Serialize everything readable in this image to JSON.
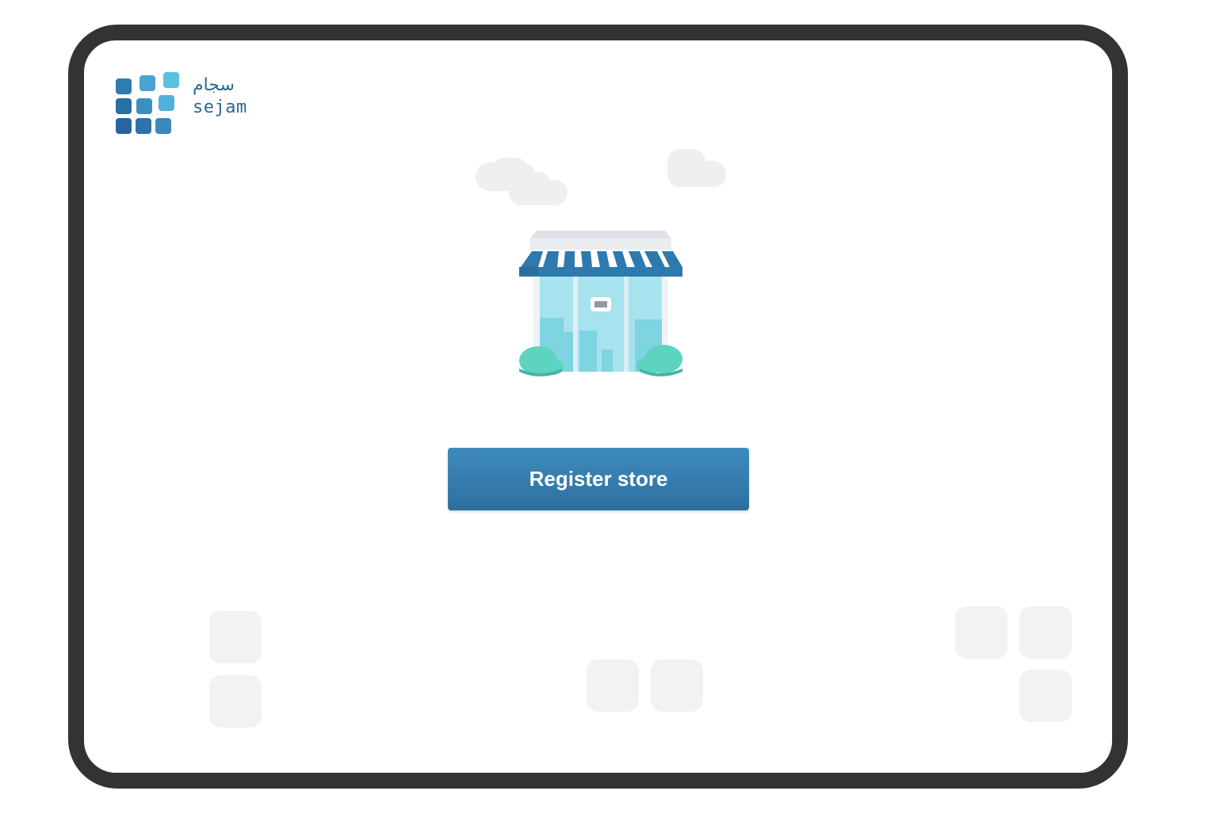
{
  "brand": {
    "name_arabic": "سجام",
    "name_latin": "sejam",
    "primary_color": "#2b6a91",
    "accent_color": "#3f8bbd"
  },
  "illustration": {
    "icon": "storefront-icon"
  },
  "actions": {
    "register_label": "Register store"
  },
  "icons": {
    "logo": "sejam-logo-icon",
    "cloud": "cloud-icon",
    "tile": "decorative-tile"
  }
}
